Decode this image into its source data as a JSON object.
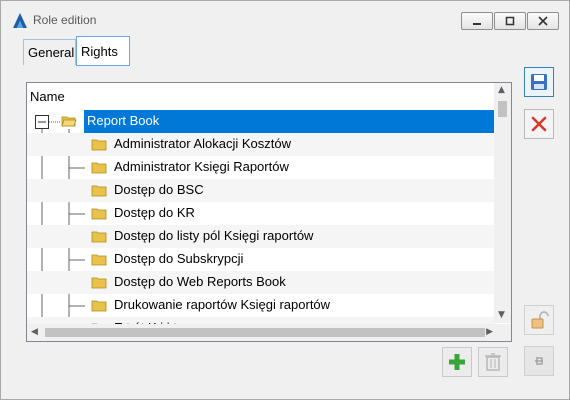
{
  "window": {
    "title": "Role edition",
    "controls": [
      "minimize",
      "maximize",
      "close"
    ]
  },
  "tabs": [
    {
      "label": "General",
      "active": false
    },
    {
      "label": "Rights",
      "active": true
    }
  ],
  "tree": {
    "column_header": "Name",
    "root": {
      "label": "Report Book",
      "expanded": true,
      "selected": true
    },
    "children": [
      "Administrator Alokacji Kosztów",
      "Administrator Księgi Raportów",
      "Dostęp do BSC",
      "Dostęp do KR",
      "Dostęp do listy pól Księgi raportów",
      "Dostęp do Subskrypcji",
      "Dostęp do Web Reports Book",
      "Drukowanie raportów Księgi raportów"
    ],
    "partial_next_label": "E        t         ót K i  i      t  "
  },
  "colors": {
    "selection": "#0078d7",
    "delete_icon": "#d83a2e",
    "add_icon": "#3aa33a",
    "save_icon": "#3b6fc2",
    "folder": "#e8c24a"
  },
  "icons": {
    "app": "app-logo-icon",
    "save": "save-icon",
    "delete": "delete-icon",
    "unlock": "padlock-icon",
    "pin": "pin-icon",
    "add": "add-icon",
    "remove": "trash-icon"
  }
}
